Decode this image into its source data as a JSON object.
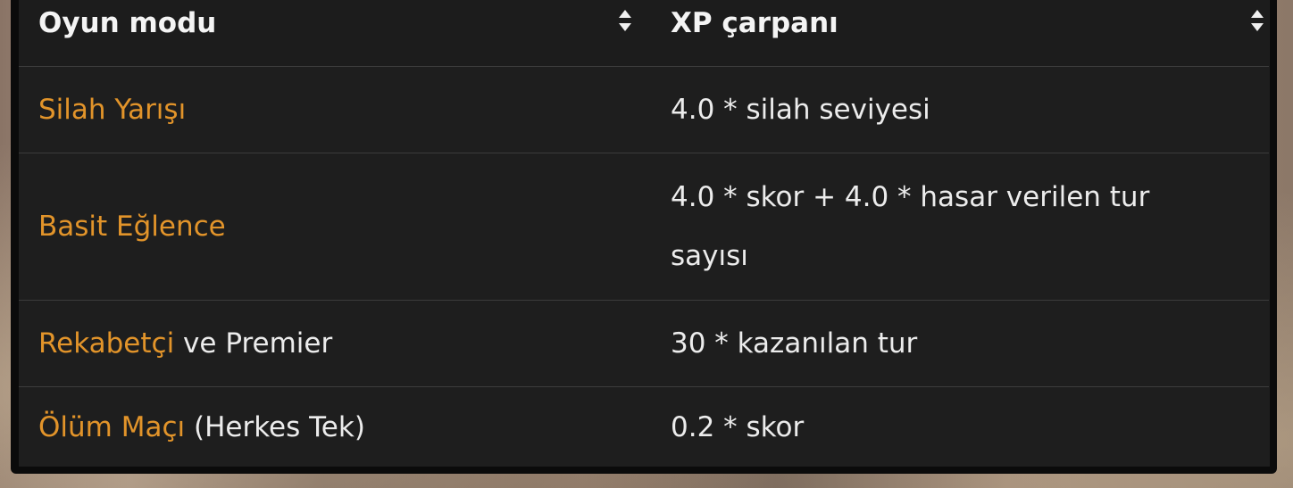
{
  "table": {
    "headers": [
      {
        "label": "Oyun modu",
        "sort_icon": "sort-arrows-icon"
      },
      {
        "label": "XP çarpanı",
        "sort_icon": "sort-arrows-icon"
      }
    ],
    "rows": [
      {
        "mode_link": "Silah Yarışı",
        "mode_suffix": "",
        "multiplier": "4.0 * silah seviyesi"
      },
      {
        "mode_link": "Basit Eğlence",
        "mode_suffix": "",
        "multiplier_line1": "4.0 * skor + 4.0 * hasar verilen tur",
        "multiplier_line2": "sayısı"
      },
      {
        "mode_link": "Rekabetçi",
        "mode_suffix": " ve Premier",
        "multiplier": "30 * kazanılan tur"
      },
      {
        "mode_link": "Ölüm Maçı",
        "mode_suffix": " (Herkes Tek)",
        "multiplier": "0.2 * skor"
      }
    ]
  },
  "colors": {
    "link": "#e2942a",
    "text": "#ececec",
    "table_bg": "#1e1e1e",
    "frame": "#0b0b0b"
  }
}
